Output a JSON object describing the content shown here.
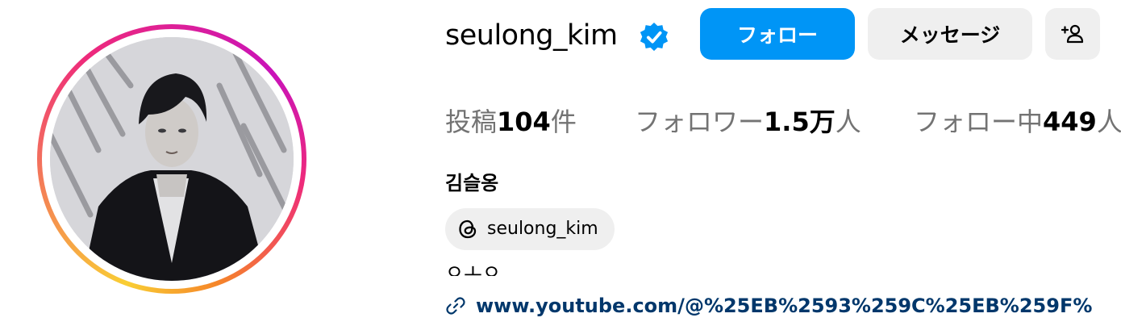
{
  "profile": {
    "username": "seulong_kim",
    "verified_icon": "verified-badge-icon",
    "full_name": "김슬옹",
    "bio": "ㅇㅗㅇ",
    "threads_handle": "seulong_kim",
    "link": "www.youtube.com/@%25EB%2593%259C%25EB%259F%"
  },
  "actions": {
    "follow_label": "フォロー",
    "message_label": "メッセージ",
    "suggest_icon": "add-person-icon"
  },
  "stats": {
    "posts_prefix": "投稿",
    "posts_value": "104",
    "posts_suffix": "件",
    "followers_prefix": "フォロワー",
    "followers_value": "1.5万",
    "followers_suffix": "人",
    "following_prefix": "フォロー中",
    "following_value": "449",
    "following_suffix": "人"
  },
  "colors": {
    "accent": "#0095f6",
    "secondary_button": "#efefef",
    "link": "#00376b",
    "muted_text": "#737373"
  }
}
